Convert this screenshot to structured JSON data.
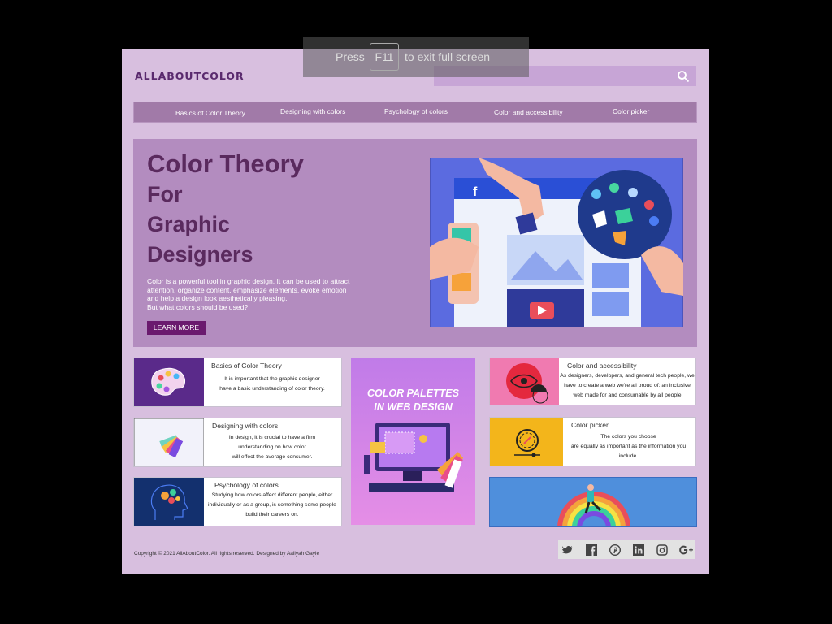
{
  "site": {
    "logo": "ALLABOUTCOLOR"
  },
  "search": {
    "placeholder": ""
  },
  "nav": {
    "items": [
      "Basics of Color Theory",
      "Designing with colors",
      "Psychology of colors",
      "Color and accessibility",
      "Color picker"
    ]
  },
  "hero": {
    "title_line1": "Color Theory",
    "title_line2": "For",
    "title_line3": "Graphic",
    "title_line4": "Designers",
    "desc_lines": [
      "Color is a powerful tool in graphic design. It can be used to attract",
      "attention, organize content, emphasize elements, evoke emotion",
      "and help a design look aesthetically pleasing.",
      "But what colors should be used?"
    ],
    "button": "LEARN MORE"
  },
  "cards": {
    "basics": {
      "title": "Basics of Color Theory",
      "lines": [
        "It is important that the graphic designer",
        "have a basic understanding of color theory."
      ]
    },
    "designing": {
      "title": "Designing with colors",
      "lines": [
        "In design, it is crucial to have a firm",
        "understanding on how color",
        "will effect the average consumer."
      ]
    },
    "psychology": {
      "title": "Psychology of colors",
      "lines": [
        "Studying how colors affect different people, either",
        "individually or as a group, is something some people",
        "build their careers on."
      ]
    },
    "accessibility": {
      "title": "Color and accessibility",
      "lines": [
        "As designers, developers, and general tech people, we",
        "have to create a web we're all proud of: an inclusive",
        "web made for and consumable by all people"
      ]
    },
    "picker": {
      "title": "Color picker",
      "lines": [
        "The colors you choose",
        "are equally as important as the information you",
        "include."
      ]
    }
  },
  "promo": {
    "line1": "COLOR PALETTES",
    "line2": "IN WEB DESIGN"
  },
  "footer": {
    "copyright": "Copyright © 2021 AllAboutColor. All rights reserved. Designed by Aaliyah Gayle"
  },
  "social": [
    "twitter-icon",
    "facebook-icon",
    "pinterest-icon",
    "linkedin-icon",
    "instagram-icon",
    "google-plus-icon"
  ],
  "fullscreen_notice": {
    "press": "Press",
    "key": "F11",
    "rest": "to exit full screen"
  },
  "colors": {
    "background": "#d8bfdf",
    "nav": "#a17aa8",
    "hero": "#b38cbf",
    "title": "#5a2a5e",
    "button": "#6a1a6e"
  }
}
